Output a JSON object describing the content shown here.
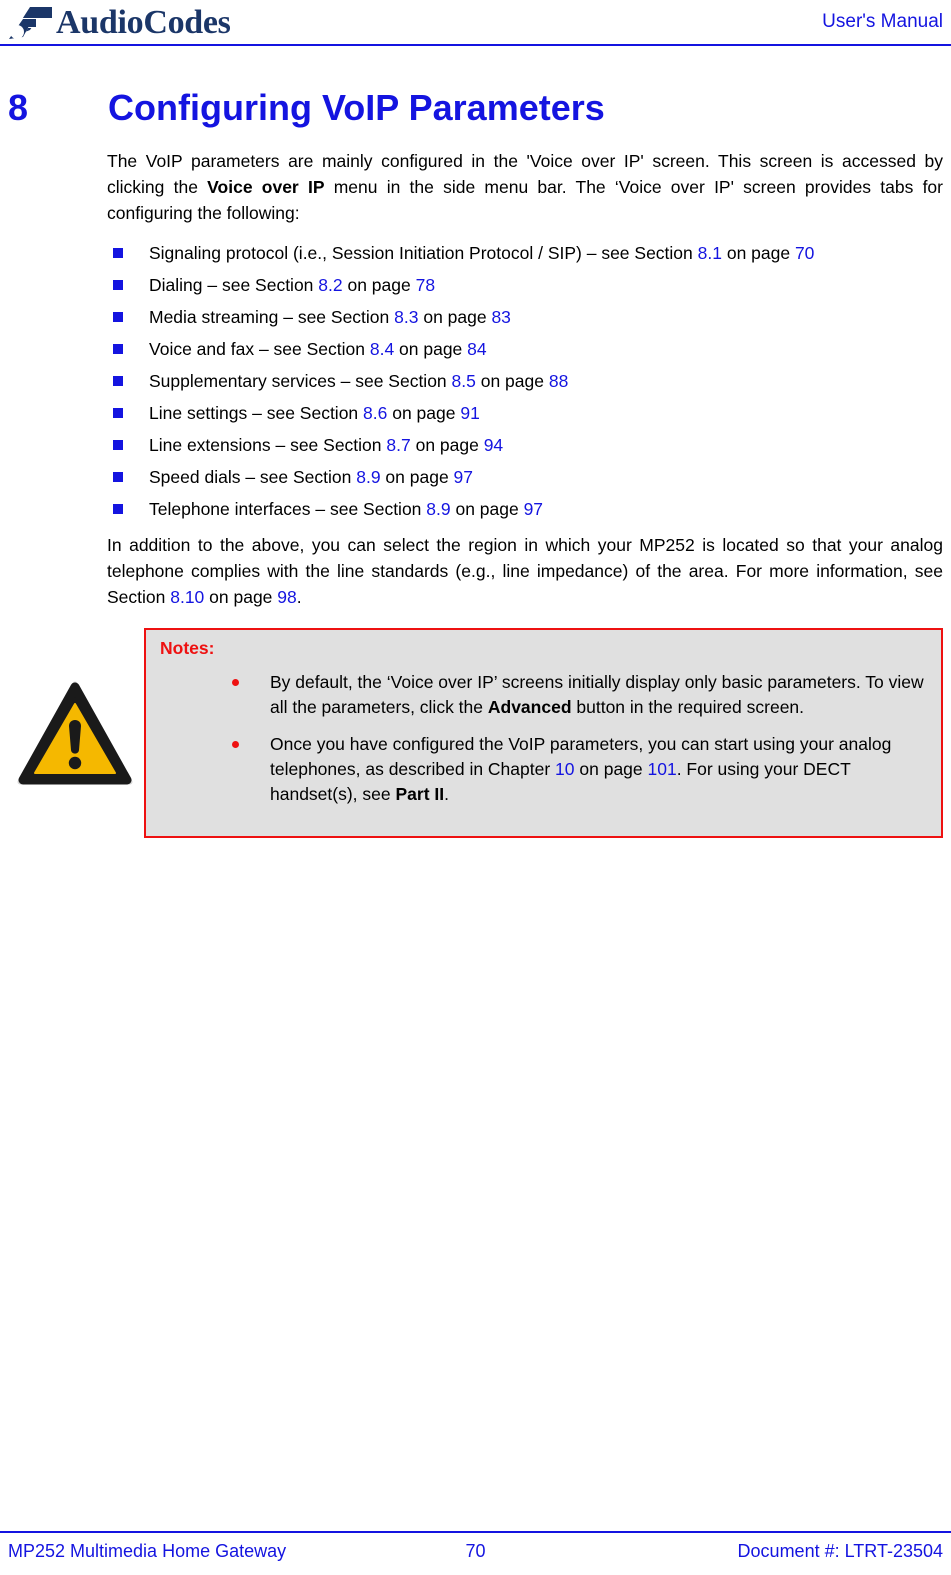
{
  "header": {
    "logo_text_audio": "Audio",
    "logo_text_codes": "Codes",
    "doc_type": "User's Manual"
  },
  "chapter": {
    "number": "8",
    "title": "Configuring VoIP Parameters"
  },
  "intro": {
    "p1_a": "The VoIP parameters are mainly configured in the 'Voice over IP' screen. This screen is accessed by clicking the ",
    "p1_bold": "Voice over IP",
    "p1_b": " menu in the side menu bar. The ‘Voice over IP' screen provides tabs for configuring the following:"
  },
  "tabs_list": [
    {
      "text_a": "Signaling protocol (i.e., Session Initiation Protocol / SIP) – see Section ",
      "section": "8.1",
      "text_b": " on page ",
      "page": "70"
    },
    {
      "text_a": "Dialing – see Section ",
      "section": "8.2",
      "text_b": " on page ",
      "page": "78"
    },
    {
      "text_a": "Media streaming – see Section ",
      "section": "8.3",
      "text_b": " on page ",
      "page": "83"
    },
    {
      "text_a": "Voice and fax – see Section ",
      "section": "8.4",
      "text_b": " on page ",
      "page": "84"
    },
    {
      "text_a": "Supplementary services – see Section ",
      "section": "8.5",
      "text_b": " on page ",
      "page": "88"
    },
    {
      "text_a": "Line settings – see Section ",
      "section": "8.6",
      "text_b": " on page ",
      "page": "91"
    },
    {
      "text_a": "Line extensions – see Section ",
      "section": "8.7",
      "text_b": " on page ",
      "page": "94"
    },
    {
      "text_a": "Speed dials – see Section ",
      "section": "8.9",
      "text_b": " on page ",
      "page": "97"
    },
    {
      "text_a": "Telephone interfaces – see Section ",
      "section": "8.9",
      "text_b": " on page ",
      "page": "97"
    }
  ],
  "closing": {
    "p2_a": "In addition to the above, you can select the region in which your MP252 is located so that your analog telephone complies with the line standards (e.g., line impedance) of the area. For more information, see Section ",
    "p2_section": "8.10",
    "p2_b": " on page ",
    "p2_page": "98",
    "p2_c": "."
  },
  "notes": {
    "title": "Notes:",
    "items": [
      {
        "a": "By default, the  ‘Voice over IP’  screens initially display only basic parameters. To view all the parameters, click the ",
        "bold": "Advanced",
        "b": " button in the required screen."
      },
      {
        "a": "Once you have configured the VoIP parameters, you can start using your analog telephones, as described in Chapter ",
        "ref1": "10",
        "b": " on page ",
        "ref2": "101",
        "c": ". For using your DECT handset(s), see ",
        "bold": "Part II",
        "d": "."
      }
    ]
  },
  "footer": {
    "left": "MP252 Multimedia Home Gateway",
    "page": "70",
    "right": "Document #: LTRT-23504"
  },
  "colors": {
    "link_blue": "#1414e0",
    "logo_navy": "#1b3668",
    "note_red": "#ee1111",
    "note_bg": "#e0e0e0",
    "warn_yellow": "#f5b800"
  }
}
